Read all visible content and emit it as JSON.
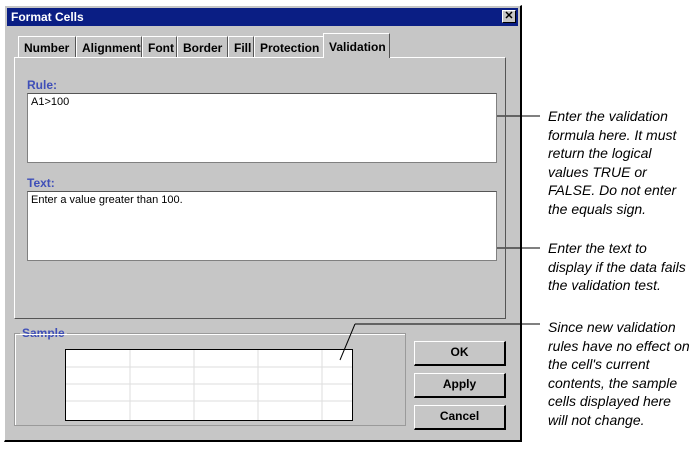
{
  "window": {
    "title": "Format Cells"
  },
  "tabs": [
    {
      "label": "Number"
    },
    {
      "label": "Alignment"
    },
    {
      "label": "Font"
    },
    {
      "label": "Border"
    },
    {
      "label": "Fill"
    },
    {
      "label": "Protection"
    },
    {
      "label": "Validation",
      "active": true
    }
  ],
  "rule": {
    "label": "Rule:",
    "value": "A1>100"
  },
  "text": {
    "label": "Text:",
    "value": "Enter a value greater than 100."
  },
  "sample": {
    "label": "Sample"
  },
  "buttons": {
    "ok": "OK",
    "apply": "Apply",
    "cancel": "Cancel"
  },
  "callouts": {
    "rule": "Enter the validation formula here. It must return the logical values TRUE or FALSE. Do not enter the equals sign.",
    "text": "Enter the text to display if the data fails the validation test.",
    "sample": "Since new validation rules have no effect on the cell's current contents, the sample cells displayed here will not change."
  },
  "colors": {
    "titlebar": "#0a1e84",
    "dialog": "#c6c6c6",
    "label": "#3f4fb8"
  },
  "icons": {
    "close": "close-icon"
  }
}
